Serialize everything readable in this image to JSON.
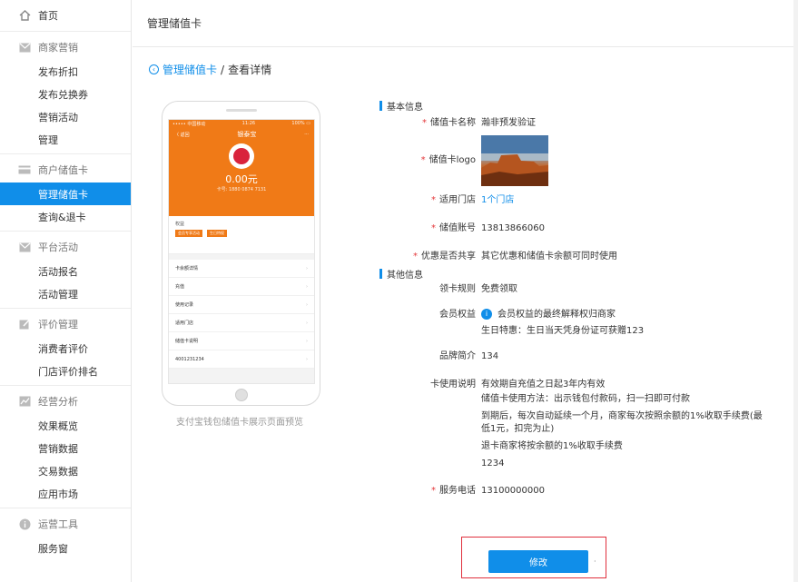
{
  "sidebar": {
    "home": "首页",
    "groups": [
      {
        "title": "商家营销",
        "icon": "mail-icon",
        "items": [
          "发布折扣",
          "发布兑换券",
          "营销活动",
          "管理"
        ]
      },
      {
        "title": "商户储值卡",
        "icon": "card-icon",
        "items": [
          "管理储值卡",
          "查询&退卡"
        ]
      },
      {
        "title": "平台活动",
        "icon": "mail-icon",
        "items": [
          "活动报名",
          "活动管理"
        ]
      },
      {
        "title": "评价管理",
        "icon": "edit-icon",
        "items": [
          "消费者评价",
          "门店评价排名"
        ]
      },
      {
        "title": "经营分析",
        "icon": "chart-icon",
        "items": [
          "效果概览",
          "营销数据",
          "交易数据",
          "应用市场"
        ]
      },
      {
        "title": "运营工具",
        "icon": "info-icon",
        "items": [
          "服务窗"
        ]
      }
    ]
  },
  "header": {
    "title": "管理储值卡"
  },
  "breadcrumb": {
    "back": "管理储值卡",
    "sep": "/",
    "current": "查看详情"
  },
  "phone": {
    "status_left": "••••• 中国移动",
    "status_mid": "11:26",
    "status_right": "100% ▭",
    "nav_back": "〈 返回",
    "nav_title": "银泰宝",
    "nav_more": "···",
    "amount": "0.00元",
    "card_no": "卡号: 1880 0874 7131",
    "rights_label": "权益",
    "tags": [
      "会员专享活动",
      "生日特权"
    ],
    "rows": [
      "卡余额详情",
      "充值",
      "使用记录",
      "适用门店",
      "储值卡说明",
      "4001231234"
    ],
    "caption": "支付宝钱包储值卡展示页面预览"
  },
  "detail": {
    "basic_title": "基本信息",
    "name_label": "储值卡名称",
    "name_value": "瀚非预发验证",
    "logo_label": "储值卡logo",
    "store_label": "适用门店",
    "store_value": "1个门店",
    "account_label": "储值账号",
    "account_value": "13813866060",
    "share_label": "优惠是否共享",
    "share_value": "其它优惠和储值卡余额可同时使用",
    "other_title": "其他信息",
    "rule_label": "领卡规则",
    "rule_value": "免费领取",
    "rights_label": "会员权益",
    "rights_line1": "会员权益的最终解释权归商家",
    "rights_line2": "生日特惠：生日当天凭身份证可获赠123",
    "brand_label": "品牌简介",
    "brand_value": "134",
    "usage_label": "卡使用说明",
    "usage_lines": [
      "有效期自充值之日起3年内有效",
      "储值卡使用方法：出示钱包付款码，扫一扫即可付款",
      "到期后，每次自动延续一个月，商家每次按照余额的1%收取手续费(最低1元，扣完为止)",
      "退卡商家将按余额的1%收取手续费",
      "1234"
    ],
    "phone_label": "服务电话",
    "phone_value": "13100000000",
    "req_mark": "*"
  },
  "actions": {
    "edit": "修改",
    "dot": "·"
  },
  "colors": {
    "accent": "#108ee9",
    "card_orange": "#f07a17",
    "required": "#e4393c",
    "highlight": "#e0303d"
  }
}
